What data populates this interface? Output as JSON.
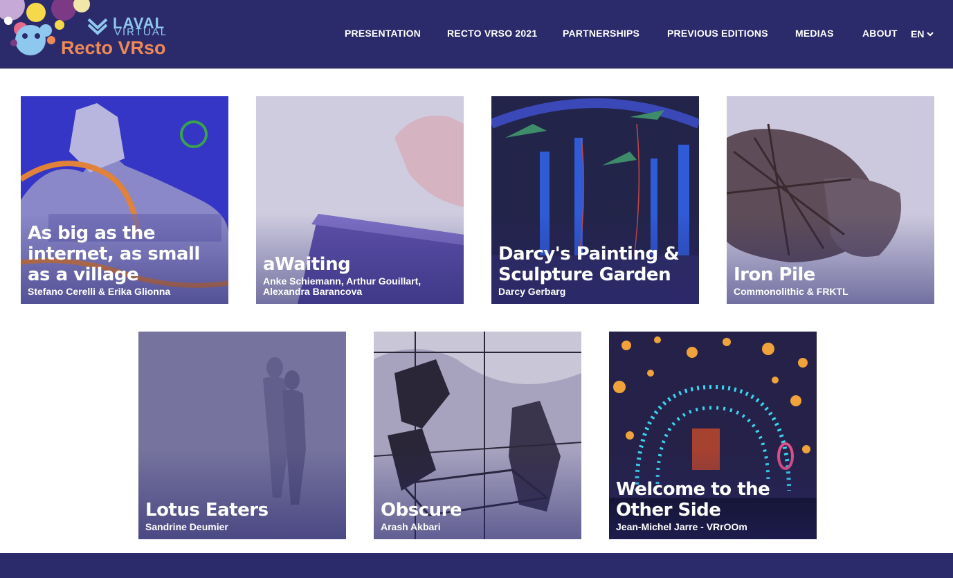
{
  "brand": {
    "laval": "LAVAL",
    "virtual": "VIRTUAL",
    "recto_vrso": "Recto VRso"
  },
  "nav": {
    "items": [
      {
        "label": "PRESENTATION"
      },
      {
        "label": "RECTO VRSO 2021"
      },
      {
        "label": "PARTNERSHIPS"
      },
      {
        "label": "PREVIOUS EDITIONS"
      },
      {
        "label": "MEDIAS"
      },
      {
        "label": "ABOUT"
      }
    ],
    "language": "EN"
  },
  "colors": {
    "header_bg": "#2b2b6b",
    "accent_orange": "#ef8a55",
    "accent_blue": "#8fc8ee"
  },
  "works": [
    {
      "title": "As big as the internet, as small as a village",
      "author": "Stefano Cerelli & Erika Glionna"
    },
    {
      "title": "aWaiting",
      "author": "Anke Schiemann, Arthur Gouillart, Alexandra Barancova"
    },
    {
      "title": "Darcy's Painting & Sculpture Garden",
      "author": "Darcy Gerbarg"
    },
    {
      "title": "Iron Pile",
      "author": "Commonolithic & FRKTL"
    },
    {
      "title": "Lotus Eaters",
      "author": "Sandrine Deumier"
    },
    {
      "title": "Obscure",
      "author": "Arash Akbari"
    },
    {
      "title": "Welcome to the Other Side",
      "author": "Jean-Michel Jarre - VRrOOm"
    }
  ]
}
